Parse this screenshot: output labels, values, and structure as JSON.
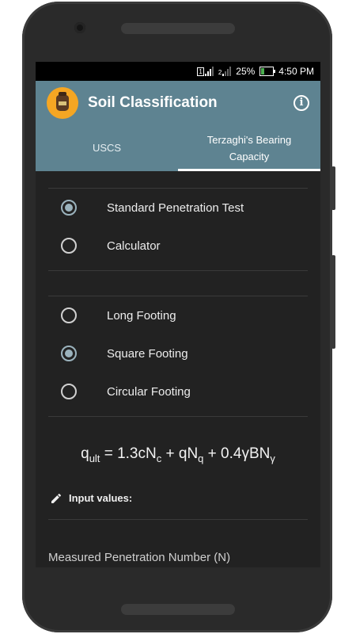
{
  "status": {
    "sim1": "1",
    "sim2": "2",
    "battery": "25%",
    "time": "4:50 PM",
    "battery_color": "#4caf50"
  },
  "app": {
    "title": "Soil Classification",
    "info_label": "i",
    "accent": "#5e8391"
  },
  "tabs": [
    {
      "label": "USCS",
      "active": false
    },
    {
      "label": "Terzaghi's Bearing Capacity",
      "active": true
    }
  ],
  "method_options": [
    {
      "label": "Standard Penetration Test",
      "checked": true
    },
    {
      "label": "Calculator",
      "checked": false
    }
  ],
  "footing_options": [
    {
      "label": "Long Footing",
      "checked": false
    },
    {
      "label": "Square Footing",
      "checked": true
    },
    {
      "label": "Circular Footing",
      "checked": false
    }
  ],
  "formula": {
    "q": "q",
    "ult": "ult",
    "eq": " = 1.3cN",
    "c": "c",
    "p2": " + qN",
    "qsub": "q",
    "p3": " + 0.4γBN",
    "gsub": "γ"
  },
  "input_section": {
    "title": "Input values:",
    "icon": "pencil-icon"
  },
  "fields": [
    {
      "placeholder": "Measured Penetration Number (N)"
    }
  ]
}
